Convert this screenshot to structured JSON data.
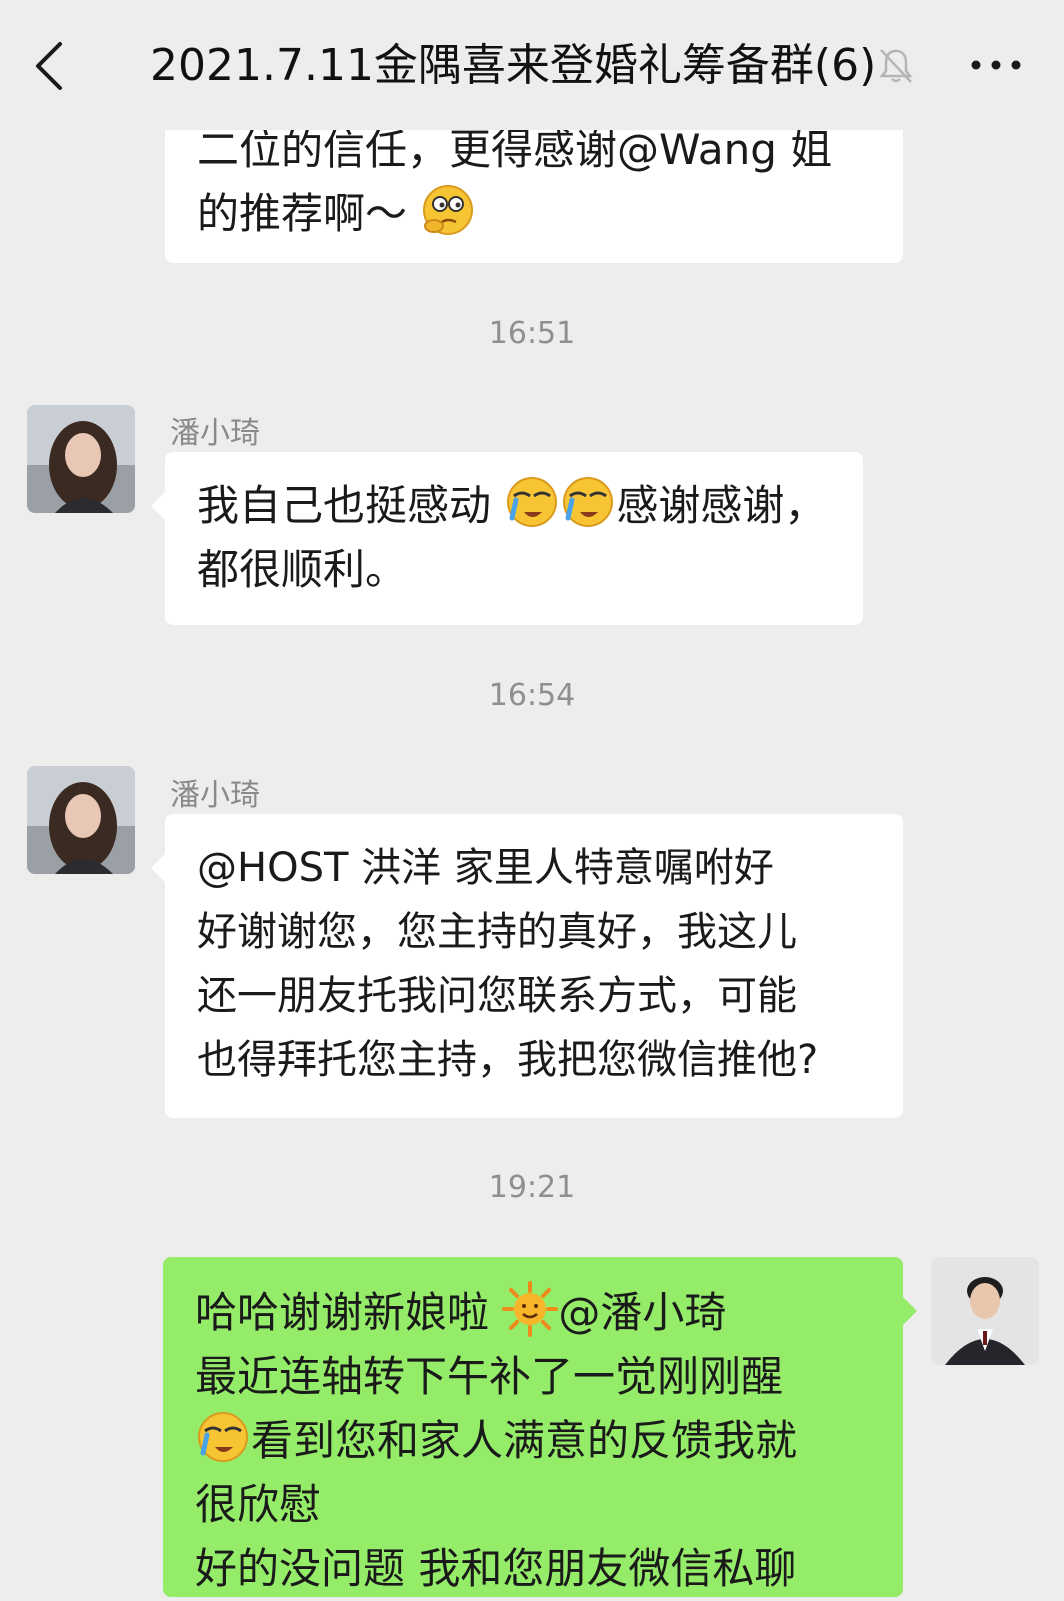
{
  "header": {
    "title": "2021.7.11金隅喜来登婚礼筹备群(6)",
    "back_icon": "back-chevron-icon",
    "mute_icon": "mute-bell-icon",
    "more_icon": "more-dots-icon"
  },
  "messages": [
    {
      "lines": [
        "二位的信任，更得感谢@Wang 姐",
        "的推荐啊～"
      ],
      "emoji": "thinking-emoji"
    },
    {
      "time": "16:51"
    },
    {
      "sender": "潘小琦",
      "lines": [
        "我自己也挺感动",
        "感谢感谢，",
        "都很顺利。"
      ],
      "emoji": "crying-face-emoji"
    },
    {
      "time": "16:54"
    },
    {
      "sender": "潘小琦",
      "lines": [
        "@HOST 洪洋  家里人特意嘱咐好",
        "好谢谢您，您主持的真好，我这儿",
        "还一朋友托我问您联系方式，可能",
        "也得拜托您主持，我把您微信推他?"
      ]
    },
    {
      "time": "19:21"
    },
    {
      "lines": [
        "哈哈谢谢新娘啦",
        "@潘小琦",
        "最近连轴转下午补了一觉刚刚醒",
        "看到您和家人满意的反馈我就",
        "很欣慰",
        "好的没问题 我和您朋友微信私聊"
      ],
      "emoji": [
        "sun-face-emoji",
        "crying-face-emoji"
      ]
    }
  ],
  "colors": {
    "background": "#ededed",
    "bubble_in": "#ffffff",
    "bubble_out": "#95ec69",
    "time_text": "#8f8f8f"
  }
}
